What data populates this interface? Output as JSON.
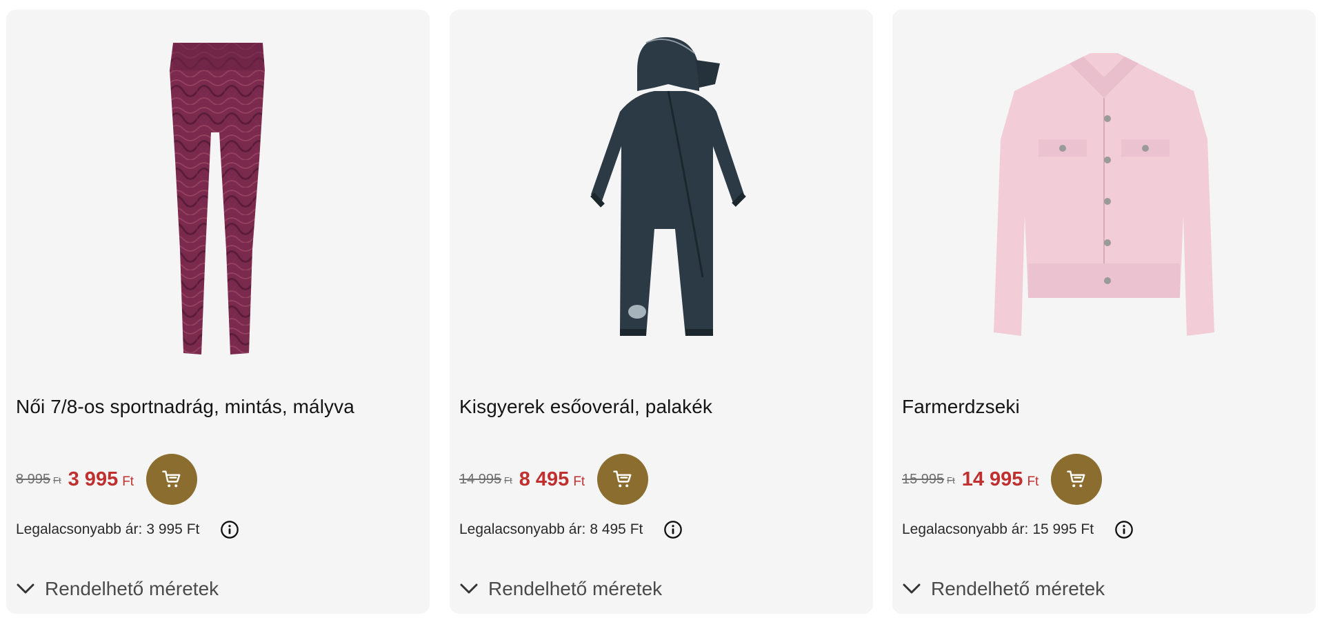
{
  "products": [
    {
      "title": "Női 7/8-os sportnadrág, mintás, mályva",
      "old_price": "8 995",
      "old_currency": "Ft",
      "new_price": "3 995",
      "new_currency": "Ft",
      "lowest_label": "Legalacsonyabb ár:",
      "lowest_value": "3 995 Ft",
      "sizes_label": "Rendelhető méretek"
    },
    {
      "title": "Kisgyerek esőoverál, palakék",
      "old_price": "14 995",
      "old_currency": "Ft",
      "new_price": "8 495",
      "new_currency": "Ft",
      "lowest_label": "Legalacsonyabb ár:",
      "lowest_value": "8 495 Ft",
      "sizes_label": "Rendelhető méretek"
    },
    {
      "title": "Farmerdzseki",
      "old_price": "15 995",
      "old_currency": "Ft",
      "new_price": "14 995",
      "new_currency": "Ft",
      "lowest_label": "Legalacsonyabb ár:",
      "lowest_value": "15 995 Ft",
      "sizes_label": "Rendelhető méretek"
    }
  ],
  "icons": {
    "cart": "shopping-cart-icon",
    "info": "info-circle-icon",
    "chevron": "chevron-down-icon"
  },
  "colors": {
    "card_bg": "#f5f5f5",
    "sale_price": "#c0302f",
    "cart_button": "#8a6d2f",
    "leggings": "#7a2a4d",
    "overall": "#2b3a44",
    "jacket": "#f2cdd8"
  }
}
